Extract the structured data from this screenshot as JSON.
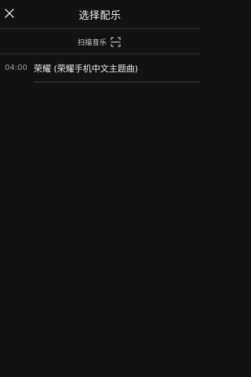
{
  "header": {
    "title": "选择配乐",
    "close_icon": "close-icon"
  },
  "scan": {
    "label": "扫描音乐",
    "icon": "scan-icon"
  },
  "songs": [
    {
      "duration": "04:00",
      "title": "荣耀 (荣耀手机中文主题曲)"
    }
  ],
  "colors": {
    "background": "#121212",
    "divider": "#2e2e2e",
    "text_primary": "#ececec",
    "text_secondary": "#9a9a9a"
  }
}
